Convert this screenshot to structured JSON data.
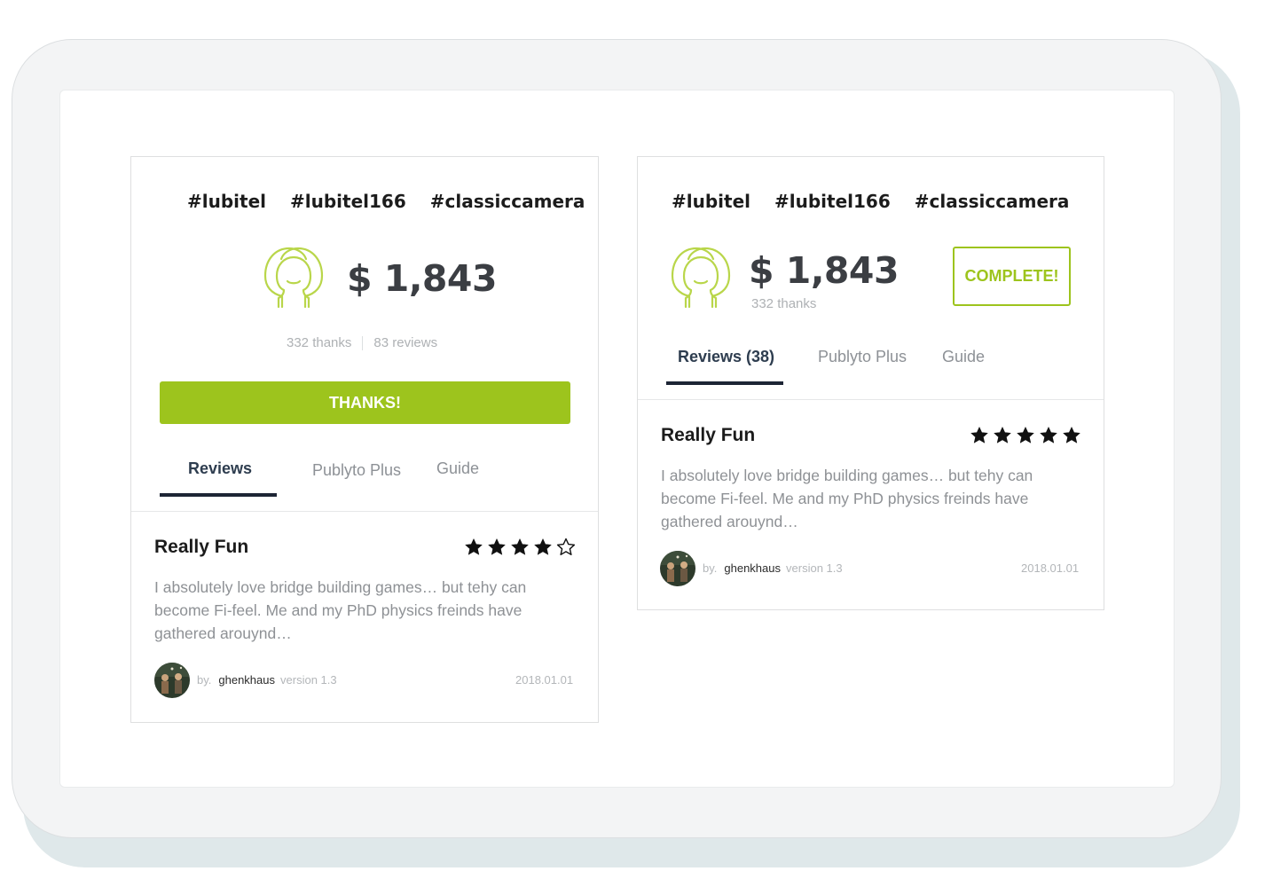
{
  "colors": {
    "accent_green": "#9dc41d",
    "dark_text": "#1c1c1c",
    "muted_text": "#8e9195",
    "tab_active": "#2e3d4f"
  },
  "cards": [
    {
      "tags": [
        "#lubitel",
        "#lubitel166",
        "#classiccamera"
      ],
      "icon": "double-head-profile-icon",
      "price": "$ 1,843",
      "thanks_count": "332 thanks",
      "reviews_count": "83 reviews",
      "thanks_button": "THANKS!",
      "tabs": [
        {
          "label": "Reviews",
          "active": true
        },
        {
          "label": "Publyto Plus",
          "active": false
        },
        {
          "label": "Guide",
          "active": false
        }
      ],
      "review": {
        "title": "Really Fun",
        "rating": 4,
        "max_rating": 5,
        "body": "I absolutely love bridge building games… but tehy can become Fi-feel. Me and my PhD physics freinds have gathered arouynd…",
        "by_label": "by.",
        "author": "ghenkhaus",
        "version": "version 1.3",
        "date": "2018.01.01"
      }
    },
    {
      "tags": [
        "#lubitel",
        "#lubitel166",
        "#classiccamera"
      ],
      "icon": "double-head-profile-icon",
      "price": "$ 1,843",
      "thanks_count": "332 thanks",
      "complete_button": "COMPLETE!",
      "tabs": [
        {
          "label": "Reviews (38)",
          "active": true
        },
        {
          "label": "Publyto Plus",
          "active": false
        },
        {
          "label": "Guide",
          "active": false
        }
      ],
      "review": {
        "title": "Really Fun",
        "rating": 5,
        "max_rating": 5,
        "body": "I absolutely love bridge building games… but tehy can become Fi-feel. Me and my PhD physics freinds have gathered arouynd…",
        "by_label": "by.",
        "author": "ghenkhaus",
        "version": "version 1.3",
        "date": "2018.01.01"
      }
    }
  ]
}
